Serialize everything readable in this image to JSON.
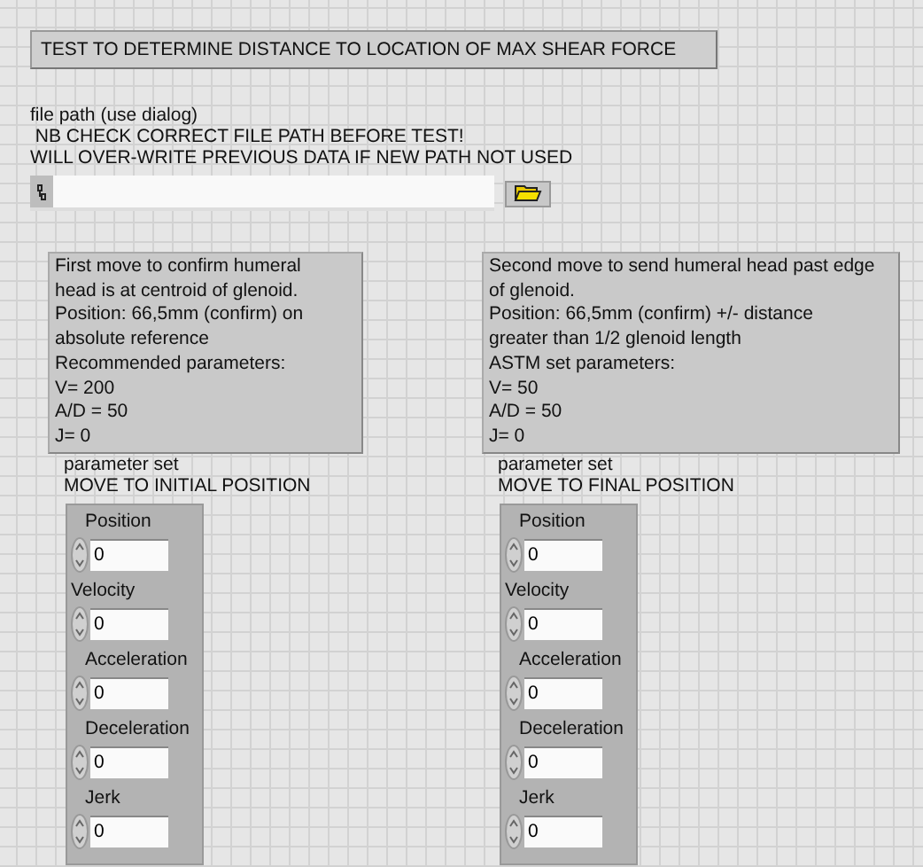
{
  "title": "TEST TO DETERMINE DISTANCE TO LOCATION OF MAX SHEAR FORCE",
  "file_path": {
    "label_lines": [
      "file path (use dialog)",
      " NB CHECK CORRECT FILE PATH BEFORE TEST!",
      "WILL OVER-WRITE PREVIOUS DATA IF NEW PATH NOT USED"
    ]
  },
  "moves": [
    {
      "note_lines": [
        "First move to confirm humeral",
        "head is at centroid of glenoid.",
        "Position: 66,5mm (confirm) on",
        "absolute reference",
        "Recommended parameters:",
        "V= 200",
        "A/D = 50",
        "J= 0"
      ],
      "cluster_label": [
        "parameter set",
        "MOVE TO INITIAL POSITION"
      ],
      "parameters": [
        {
          "label": "Position",
          "value": "0"
        },
        {
          "label": "Velocity",
          "value": "0"
        },
        {
          "label": "Acceleration",
          "value": "0"
        },
        {
          "label": "Deceleration",
          "value": "0"
        },
        {
          "label": "Jerk",
          "value": "0"
        }
      ]
    },
    {
      "note_lines": [
        "Second move to send humeral head past edge",
        "of glenoid.",
        "Position: 66,5mm (confirm) +/- distance",
        "greater than 1/2 glenoid length",
        "ASTM set parameters:",
        "V= 50",
        "A/D = 50",
        "J= 0"
      ],
      "cluster_label": [
        "parameter set",
        "MOVE TO FINAL POSITION"
      ],
      "parameters": [
        {
          "label": "Position",
          "value": "0"
        },
        {
          "label": "Velocity",
          "value": "0"
        },
        {
          "label": "Acceleration",
          "value": "0"
        },
        {
          "label": "Deceleration",
          "value": "0"
        },
        {
          "label": "Jerk",
          "value": "0"
        }
      ]
    }
  ]
}
